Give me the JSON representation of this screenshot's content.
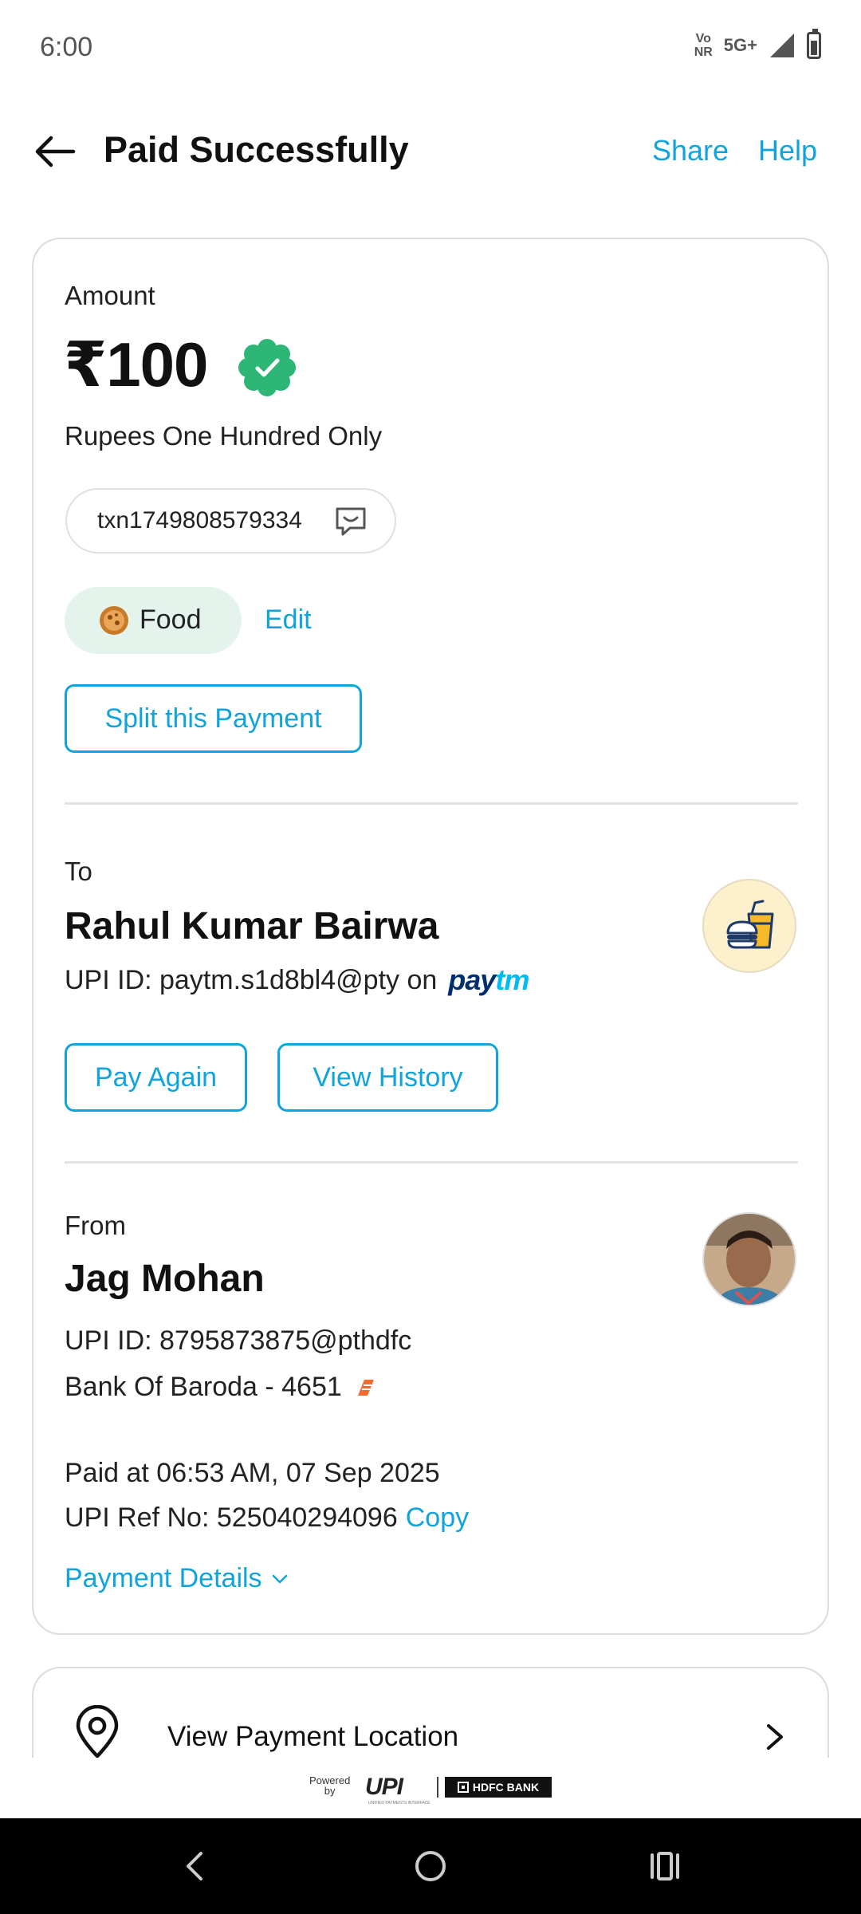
{
  "status_bar": {
    "time": "6:00",
    "volte_line1": "Vo",
    "volte_line2": "NR",
    "network": "5G+"
  },
  "header": {
    "title": "Paid Successfully",
    "share_label": "Share",
    "help_label": "Help"
  },
  "payment": {
    "amount_label": "Amount",
    "amount": "₹100",
    "amount_words": "Rupees One Hundred Only",
    "note": "txn1749808579334",
    "category": "Food",
    "edit_label": "Edit",
    "split_label": "Split this Payment"
  },
  "payee": {
    "to_label": "To",
    "name": "Rahul Kumar Bairwa",
    "upi_text": "UPI ID: paytm.s1d8bl4@pty on",
    "app_logo_pay": "pay",
    "app_logo_tm": "tm",
    "pay_again_label": "Pay Again",
    "view_history_label": "View History"
  },
  "payer": {
    "from_label": "From",
    "name": "Jag Mohan",
    "upi_text": "UPI ID: 8795873875@pthdfc",
    "bank": "Bank Of Baroda - 4651",
    "paid_at": "Paid at 06:53 AM, 07 Sep 2025",
    "ref_text": "UPI Ref No: 525040294096",
    "copy_label": "Copy",
    "details_label": "Payment Details"
  },
  "location": {
    "label": "View Payment Location"
  },
  "footer": {
    "powered_line1": "Powered",
    "powered_line2": "by",
    "upi_logo": "UPI",
    "upi_tagline": "UNIFIED PAYMENTS INTERFACE",
    "bank_logo": "HDFC BANK"
  },
  "colors": {
    "accent": "#10a4dd",
    "verified": "#2db676",
    "category_bg": "#e4f3ec",
    "paytm_dark": "#002e6e",
    "paytm_light": "#00baf2"
  },
  "icons": [
    "back-arrow-icon",
    "verified-badge-icon",
    "chat-note-icon",
    "food-icon",
    "merchant-food-icon",
    "bank-of-baroda-icon",
    "chevron-down-icon",
    "location-pin-icon",
    "chevron-right-icon"
  ]
}
